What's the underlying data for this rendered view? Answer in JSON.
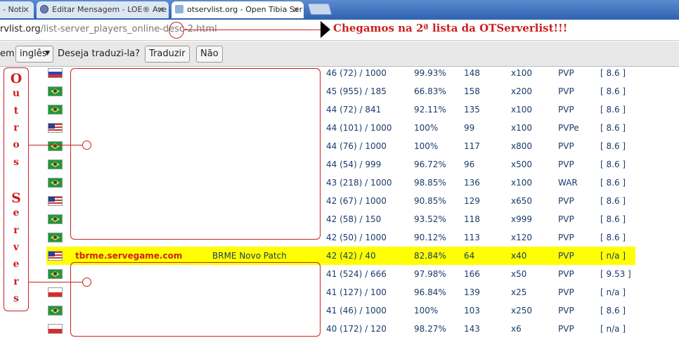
{
  "tabs": [
    {
      "label": "- Noti",
      "active": false
    },
    {
      "label": "Editar Mensagem - LOE® Ave",
      "active": false
    },
    {
      "label": "otservlist.org - Open Tibia Ser",
      "active": true
    }
  ],
  "address": {
    "host": "rvlist.org",
    "path": "/list-server_players_online-desc-2.html"
  },
  "translate": {
    "prefix": "em",
    "language": "inglês",
    "question": "Deseja traduzi-la?",
    "translate_btn": "Traduzir",
    "no_btn": "Não"
  },
  "annotation": {
    "headline": "Chegamos na 2ª lista da OTServerlist!!!",
    "side_label": [
      "O",
      "u",
      "t",
      "r",
      "o",
      "s",
      "",
      "S",
      "e",
      "r",
      "v",
      "e",
      "r",
      "s"
    ]
  },
  "rows": [
    {
      "flag": "ru",
      "name": "",
      "desc": "",
      "players": "46 (72) / 1000",
      "uptime": "99.93%",
      "ping": "148",
      "exp": "x100",
      "type": "PVP",
      "version": "[ 8.6 ]"
    },
    {
      "flag": "br",
      "name": "",
      "desc": "",
      "players": "45 (955) / 185",
      "uptime": "66.83%",
      "ping": "158",
      "exp": "x200",
      "type": "PVP",
      "version": "[ 8.6 ]"
    },
    {
      "flag": "br",
      "name": "",
      "desc": "",
      "players": "44 (72) / 841",
      "uptime": "92.11%",
      "ping": "135",
      "exp": "x100",
      "type": "PVP",
      "version": "[ 8.6 ]"
    },
    {
      "flag": "us",
      "name": "",
      "desc": "",
      "players": "44 (101) / 1000",
      "uptime": "100%",
      "ping": "99",
      "exp": "x100",
      "type": "PVPe",
      "version": "[ 8.6 ]"
    },
    {
      "flag": "br",
      "name": "",
      "desc": "",
      "players": "44 (76) / 1000",
      "uptime": "100%",
      "ping": "117",
      "exp": "x800",
      "type": "PVP",
      "version": "[ 8.6 ]"
    },
    {
      "flag": "br",
      "name": "",
      "desc": "",
      "players": "44 (54) / 999",
      "uptime": "96.72%",
      "ping": "96",
      "exp": "x500",
      "type": "PVP",
      "version": "[ 8.6 ]"
    },
    {
      "flag": "br",
      "name": "",
      "desc": "",
      "players": "43 (218) / 1000",
      "uptime": "98.85%",
      "ping": "136",
      "exp": "x100",
      "type": "WAR",
      "version": "[ 8.6 ]"
    },
    {
      "flag": "us",
      "name": "",
      "desc": "",
      "players": "42 (67) / 1000",
      "uptime": "90.85%",
      "ping": "129",
      "exp": "x650",
      "type": "PVP",
      "version": "[ 8.6 ]"
    },
    {
      "flag": "br",
      "name": "",
      "desc": "",
      "players": "42 (58) / 150",
      "uptime": "93.52%",
      "ping": "118",
      "exp": "x999",
      "type": "PVP",
      "version": "[ 8.6 ]"
    },
    {
      "flag": "br",
      "name": "",
      "desc": "",
      "players": "42 (50) / 1000",
      "uptime": "90.12%",
      "ping": "113",
      "exp": "x120",
      "type": "PVP",
      "version": "[ 8.6 ]"
    },
    {
      "flag": "us",
      "name": "tbrme.servegame.com",
      "desc": "BRME Novo Patch",
      "players": "42 (42) / 40",
      "uptime": "82.84%",
      "ping": "64",
      "exp": "x40",
      "type": "PVP",
      "version": "[ n/a ]",
      "highlight": true
    },
    {
      "flag": "br",
      "name": "",
      "desc": "",
      "players": "41 (524) / 666",
      "uptime": "97.98%",
      "ping": "166",
      "exp": "x50",
      "type": "PVP",
      "version": "[ 9.53 ]"
    },
    {
      "flag": "pl",
      "name": "",
      "desc": "",
      "players": "41 (127) / 100",
      "uptime": "96.84%",
      "ping": "139",
      "exp": "x25",
      "type": "PVP",
      "version": "[ n/a ]"
    },
    {
      "flag": "br",
      "name": "",
      "desc": "",
      "players": "41 (46) / 1000",
      "uptime": "100%",
      "ping": "103",
      "exp": "x250",
      "type": "PVP",
      "version": "[ 8.6 ]"
    },
    {
      "flag": "pl",
      "name": "",
      "desc": "",
      "players": "40 (172) / 120",
      "uptime": "98.27%",
      "ping": "143",
      "exp": "x6",
      "type": "PVP",
      "version": "[ n/a ]"
    }
  ]
}
